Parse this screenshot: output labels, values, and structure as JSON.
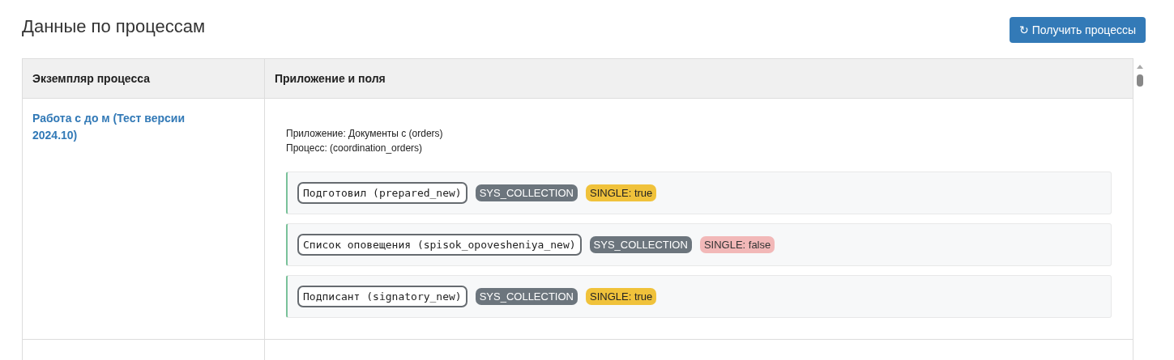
{
  "title": "Данные по процессам",
  "refresh_button": {
    "icon": "↻",
    "label": "Получить процессы"
  },
  "table": {
    "columns": [
      "Экземпляр процесса",
      "Приложение и поля"
    ],
    "rows": [
      {
        "process": "Работа с до  м (Тест версии 2024.10)",
        "app_line": "Приложение: Документы с  (orders)",
        "process_line": "Процесс: (coordination_orders)",
        "fields": [
          {
            "name": "Подготовил (prepared_new)",
            "type": "SYS_COLLECTION",
            "single_label": "SINGLE: true",
            "single": true
          },
          {
            "name": "Список оповещения (spisok_opovesheniya_new)",
            "type": "SYS_COLLECTION",
            "single_label": "SINGLE: false",
            "single": false
          },
          {
            "name": "Подписант (signatory_new)",
            "type": "SYS_COLLECTION",
            "single_label": "SINGLE: true",
            "single": true
          }
        ]
      }
    ]
  }
}
